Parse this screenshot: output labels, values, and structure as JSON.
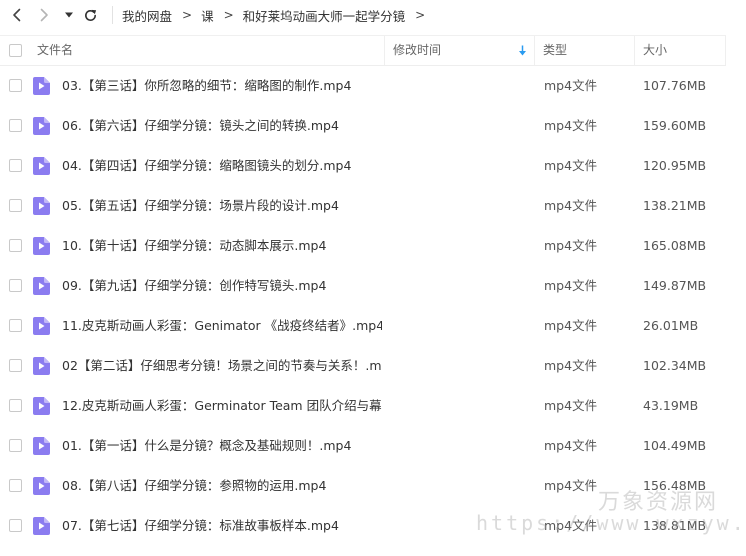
{
  "nav": {
    "back_icon": "chevron-left-icon",
    "forward_icon": "chevron-right-icon",
    "history_icon": "caret-down-icon",
    "refresh_icon": "refresh-icon"
  },
  "breadcrumb": {
    "items": [
      "我的网盘",
      "课",
      "和好莱坞动画大师一起学分镜"
    ],
    "separator": ">"
  },
  "table": {
    "columns": {
      "name": "文件名",
      "modified": "修改时间",
      "type": "类型",
      "size": "大小"
    },
    "sort_icon": "sort-down-arrow-icon",
    "accent_color": "#2a9bf0",
    "icon_color": "#8b7cf0",
    "rows": [
      {
        "name": "03.【第三话】你所忽略的细节：缩略图的制作.mp4",
        "type": "mp4文件",
        "size": "107.76MB"
      },
      {
        "name": "06.【第六话】仔细学分镜：镜头之间的转换.mp4",
        "type": "mp4文件",
        "size": "159.60MB"
      },
      {
        "name": "04.【第四话】仔细学分镜：缩略图镜头的划分.mp4",
        "type": "mp4文件",
        "size": "120.95MB"
      },
      {
        "name": "05.【第五话】仔细学分镜：场景片段的设计.mp4",
        "type": "mp4文件",
        "size": "138.21MB"
      },
      {
        "name": "10.【第十话】仔细学分镜：动态脚本展示.mp4",
        "type": "mp4文件",
        "size": "165.08MB"
      },
      {
        "name": "09.【第九话】仔细学分镜：创作特写镜头.mp4",
        "type": "mp4文件",
        "size": "149.87MB"
      },
      {
        "name": "11.皮克斯动画人彩蛋：Genimator 《战疫终结者》.mp4",
        "type": "mp4文件",
        "size": "26.01MB"
      },
      {
        "name": "02【第二话】仔细思考分镜！场景之间的节奏与关系！.m...",
        "type": "mp4文件",
        "size": "102.34MB"
      },
      {
        "name": "12.皮克斯动画人彩蛋：Germinator Team 团队介绍与幕...",
        "type": "mp4文件",
        "size": "43.19MB"
      },
      {
        "name": "01.【第一话】什么是分镜？概念及基础规则！.mp4",
        "type": "mp4文件",
        "size": "104.49MB"
      },
      {
        "name": "08.【第八话】仔细学分镜：参照物的运用.mp4",
        "type": "mp4文件",
        "size": "156.48MB"
      },
      {
        "name": "07.【第七话】仔细学分镜：标准故事板样本.mp4",
        "type": "mp4文件",
        "size": "138.81MB"
      }
    ]
  },
  "watermark": {
    "title": "万象资源网",
    "url": "https://www.wxzyw.cn"
  }
}
